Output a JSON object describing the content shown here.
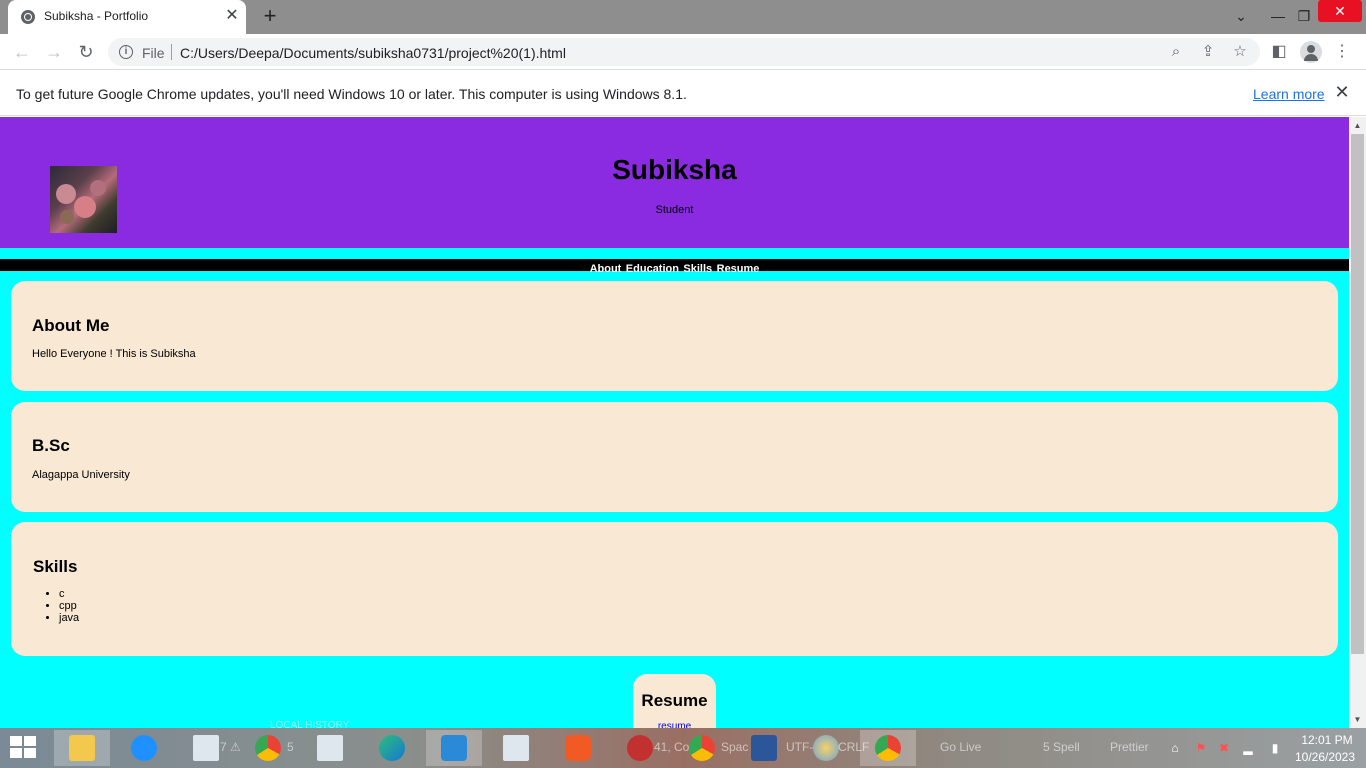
{
  "browser": {
    "tab": {
      "title": "Subiksha - Portfolio",
      "close": "✕"
    },
    "new_tab": "+",
    "window_controls": {
      "dropdown": "⌄",
      "minimize": "—",
      "restore": "❐",
      "close": "✕"
    },
    "omnibox": {
      "scheme_label": "File",
      "url": "C:/Users/Deepa/Documents/subiksha0731/project%20(1).html"
    },
    "infobar": {
      "message": "To get future Google Chrome updates, you'll need Windows 10 or later. This computer is using Windows 8.1.",
      "learn_more": "Learn more",
      "close": "✕"
    }
  },
  "page": {
    "header": {
      "title": "Subiksha",
      "subtitle": "Student"
    },
    "nav": {
      "items": [
        "About",
        "Education",
        "Skills",
        "Resume"
      ]
    },
    "about": {
      "heading": "About Me",
      "text": "Hello Everyone ! This is Subiksha"
    },
    "education": {
      "heading": "B.Sc",
      "text": "Alagappa University"
    },
    "skills": {
      "heading": "Skills",
      "items": [
        "c",
        "cpp",
        "java"
      ]
    },
    "resume": {
      "heading": "Resume",
      "link": "resume"
    },
    "colors": {
      "header_bg": "#8a2be2",
      "page_bg": "#00ffff",
      "card_bg": "#f8e8d4",
      "nav_bg": "#000000"
    }
  },
  "taskbar": {
    "ghost_labels": [
      "7 ⚠",
      "5",
      "Spac",
      "UTF-",
      "CRLF",
      "Go Live",
      "5 Spell",
      "Prettier",
      "41, Co",
      "LOCAL HISTORY"
    ],
    "clock": {
      "time": "12:01 PM",
      "date": "10/26/2023"
    }
  }
}
